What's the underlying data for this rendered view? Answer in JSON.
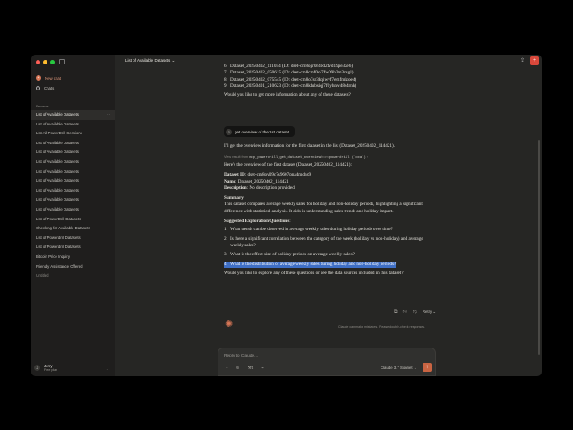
{
  "sidebar": {
    "new_chat": "New chat",
    "chats": "Chats",
    "recents_label": "Recents",
    "recents": [
      "List of Available Datasets",
      "List of Available Datasets",
      "List All PowerDrill Sessions",
      "List of Available Datasets",
      "List of Available Datasets",
      "List of Available Datasets",
      "List of Available Datasets",
      "List of Available Datasets",
      "List of Available Datasets",
      "List of Available Datasets",
      "List of Available Datasets",
      "List of PowerDrill Datasets",
      "Checking for Available Datasets",
      "List of Powerdrill Datasets",
      "List of Powerdrill Datasets",
      "Bitcoin Price Inquiry",
      "Friendly Assistance Offered",
      "Untitled"
    ],
    "active_menu": "···",
    "user": {
      "initial": "J",
      "name": "Jerry",
      "plan": "Free plan"
    }
  },
  "topbar": {
    "title": "List of Available Datasets",
    "title_chevron": "⌄",
    "share_icon": "share-icon",
    "new_button": "+"
  },
  "conversation": {
    "list_items": [
      {
        "n": "6.",
        "text": "Dataset_20250402_111054 (ID: dset-cm8ogr0r40d2fvd19pe3ze6)"
      },
      {
        "n": "7.",
        "text": "Dataset_20250402_050615 (ID: dset-cm8cmf0ol7fw09h3m3nsgl)"
      },
      {
        "n": "8.",
        "text": "Dataset_20250402_075545 (ID: dset-cm8o7sr3kqiwvf7emfmlzoe4)"
      },
      {
        "n": "9.",
        "text": "Dataset_20250401_210623 (ID: dset-cm8kfubsiqj7f0yhnw48s4rnk)"
      }
    ],
    "question_more": "Would you like to get more information about any of these datasets?",
    "user_avatar": "J",
    "user_message": "get overview of the 1st dataset",
    "assistant_intro": "I'll get the overview information for the first dataset in the list (Dataset_20250402_114421).",
    "tool_view": "View result from",
    "tool_name": "mcp_powerdrill_get_dataset_overview",
    "tool_from": "from",
    "tool_server": "powerdrill (local)",
    "tool_chevron": "›",
    "overview_intro": "Here's the overview of the first dataset (Dataset_20250402_114421):",
    "id_label": "Dataset ID",
    "id_value": ": dset-cm8ov09c7s9607pna4mohs9",
    "name_label": "Name",
    "name_value": ": Dataset_20250402_114421",
    "desc_label": "Description",
    "desc_value": ": No description provided",
    "summary_label": "Summary",
    "summary_colon": ":",
    "summary_text": "This dataset compares average weekly sales for holiday and non-holiday periods, highlighting a significant difference with statistical analysis. It aids in understanding sales trends and holiday impact.",
    "suggested_label": "Suggested Exploration Questions",
    "suggested_colon": ":",
    "questions": [
      {
        "n": "1.",
        "text": "What trends can be observed in average weekly sales during holiday periods over time?"
      },
      {
        "n": "2.",
        "text": "Is there a significant correlation between the category of the week (holiday vs non-holiday) and average weekly sales?"
      },
      {
        "n": "3.",
        "text": "What is the effect size of holiday periods on average weekly sales?"
      },
      {
        "n": "4.",
        "text": "What is the distribution of average weekly sales during holiday and non-holiday periods?"
      }
    ],
    "closing": "Would you like to explore any of these questions or see the data sources included in this dataset?",
    "retry_label": "Retry",
    "retry_chevron": "⌄",
    "disclaimer": "Claude can make mistakes. Please double-check responses."
  },
  "composer": {
    "placeholder": "Reply to Claude...",
    "model": "Claude 3.7 Sonnet",
    "model_chevron": "⌄",
    "tool_count": "4",
    "send": "↑"
  },
  "colors": {
    "accent": "#d97757",
    "send": "#c96442",
    "highlight": "#3f6fc5",
    "background": "#262624",
    "sidebar": "#1f1e1d"
  }
}
